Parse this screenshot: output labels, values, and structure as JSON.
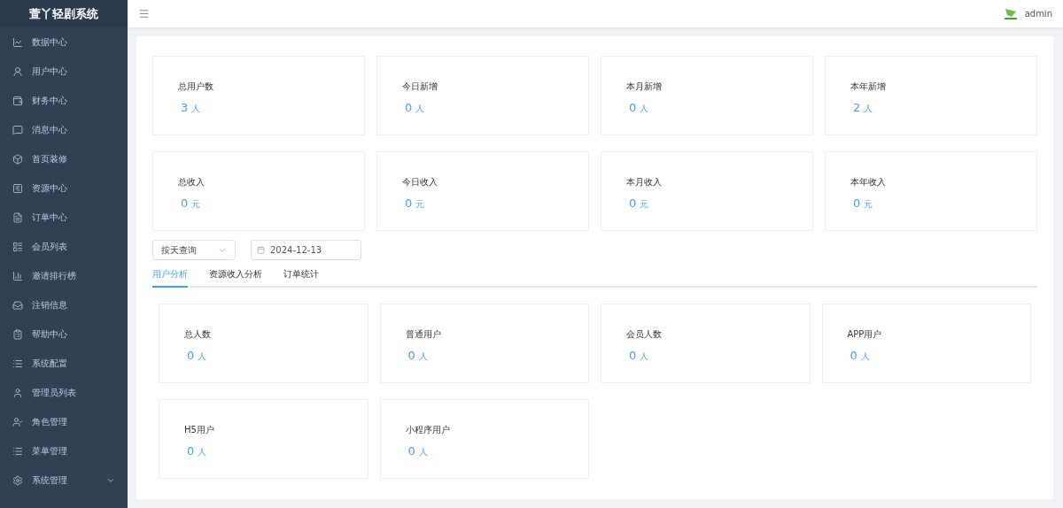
{
  "sidebar": {
    "title": "萱丫轻剧系统",
    "items": [
      {
        "label": "数据中心",
        "selected": false
      },
      {
        "label": "用户中心",
        "selected": false
      },
      {
        "label": "财务中心",
        "selected": false
      },
      {
        "label": "消息中心",
        "selected": false
      },
      {
        "label": "首页装修",
        "selected": false
      },
      {
        "label": "资源中心",
        "selected": false
      },
      {
        "label": "订单中心",
        "selected": false
      },
      {
        "label": "会员列表",
        "selected": false
      },
      {
        "label": "邀请排行榜",
        "selected": false
      },
      {
        "label": "注销信息",
        "selected": false
      },
      {
        "label": "帮助中心",
        "selected": false
      },
      {
        "label": "系统配置",
        "selected": false
      },
      {
        "label": "管理员列表",
        "selected": false
      },
      {
        "label": "角色管理",
        "selected": false
      },
      {
        "label": "菜单管理",
        "selected": false
      },
      {
        "label": "系统管理",
        "selected": false,
        "expandable": true
      }
    ]
  },
  "header": {
    "user": "admin"
  },
  "summary_cards": [
    {
      "label": "总用户数",
      "value": "3",
      "unit": "人"
    },
    {
      "label": "今日新增",
      "value": "0",
      "unit": "人"
    },
    {
      "label": "本月新增",
      "value": "0",
      "unit": "人"
    },
    {
      "label": "本年新增",
      "value": "2",
      "unit": "人"
    },
    {
      "label": "总收入",
      "value": "0",
      "unit": "元"
    },
    {
      "label": "今日收入",
      "value": "0",
      "unit": "元"
    },
    {
      "label": "本月收入",
      "value": "0",
      "unit": "元"
    },
    {
      "label": "本年收入",
      "value": "0",
      "unit": "元"
    }
  ],
  "filters": {
    "mode": "按天查询",
    "date": "2024-12-13"
  },
  "tabs": [
    {
      "label": "用户分析",
      "selected": true
    },
    {
      "label": "资源收入分析",
      "selected": false
    },
    {
      "label": "订单统计",
      "selected": false
    }
  ],
  "detail_cards": [
    {
      "label": "总人数",
      "value": "0",
      "unit": "人"
    },
    {
      "label": "普通用户",
      "value": "0",
      "unit": "人"
    },
    {
      "label": "会员人数",
      "value": "0",
      "unit": "人"
    },
    {
      "label": "APP用户",
      "value": "0",
      "unit": "人"
    },
    {
      "label": "H5用户",
      "value": "0",
      "unit": "人"
    },
    {
      "label": "小程序用户",
      "value": "0",
      "unit": "人"
    }
  ]
}
